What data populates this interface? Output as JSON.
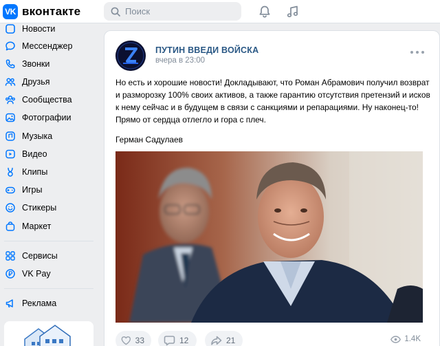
{
  "header": {
    "logo_mark": "VK",
    "logo_text": "вконтакте",
    "search_placeholder": "Поиск",
    "icons": [
      "bell-icon",
      "music-note-icon"
    ]
  },
  "sidebar": {
    "items": [
      {
        "label": "Новости",
        "icon": "news-icon"
      },
      {
        "label": "Мессенджер",
        "icon": "chat-bubble-icon"
      },
      {
        "label": "Звонки",
        "icon": "phone-icon"
      },
      {
        "label": "Друзья",
        "icon": "friends-icon"
      },
      {
        "label": "Сообщества",
        "icon": "communities-icon"
      },
      {
        "label": "Фотографии",
        "icon": "photo-icon"
      },
      {
        "label": "Музыка",
        "icon": "music-icon"
      },
      {
        "label": "Видео",
        "icon": "video-icon"
      },
      {
        "label": "Клипы",
        "icon": "clips-icon"
      },
      {
        "label": "Игры",
        "icon": "gamepad-icon"
      },
      {
        "label": "Стикеры",
        "icon": "smile-icon"
      },
      {
        "label": "Маркет",
        "icon": "bag-icon"
      },
      {
        "label": "Сервисы",
        "icon": "services-grid-icon"
      },
      {
        "label": "VK Pay",
        "icon": "ruble-coin-icon"
      },
      {
        "label": "Реклама",
        "icon": "megaphone-icon"
      }
    ]
  },
  "post": {
    "author": "ПУТИН ВВЕДИ ВОЙСКА",
    "time": "вчера в 23:00",
    "text": "Но есть и хорошие новости! Докладывают, что Роман Абрамович получил возврат и разморозку 100% своих активов, а также гарантию отсутствия претензий и исков к нему сейчас и в будущем в связи с санкциями и репарациями. Ну наконец-то! Прямо от сердца отлегло и гора с плеч.",
    "signature": "Герман Садулаев",
    "likes": "33",
    "comments": "12",
    "shares": "21",
    "views": "1.4K"
  },
  "colors": {
    "accent": "#0077ff",
    "link": "#2a5885",
    "page_bg": "#edeef0",
    "secondary_text": "#818c99"
  }
}
